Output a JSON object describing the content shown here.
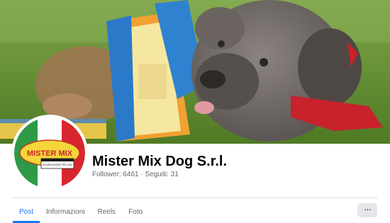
{
  "page": {
    "name": "Mister Mix Dog S.r.l.",
    "followers_label": "Follower:",
    "followers_count": "6461",
    "separator": "·",
    "following_label": "Seguiti:",
    "following_count": "31"
  },
  "tabs": [
    {
      "label": "Post",
      "active": true
    },
    {
      "label": "Informazioni",
      "active": false
    },
    {
      "label": "Reels",
      "active": false
    },
    {
      "label": "Foto",
      "active": false
    }
  ],
  "more_button": {
    "icon": "more-horizontal-icon",
    "label": "···"
  },
  "logo": {
    "brand": "MISTER MIX",
    "tagline": "ALIMENTAZIONE PER CANI E GATTI"
  },
  "colors": {
    "accent": "#1877f2",
    "text_primary": "#050505",
    "text_secondary": "#65676b",
    "button_bg": "#e4e6eb"
  }
}
